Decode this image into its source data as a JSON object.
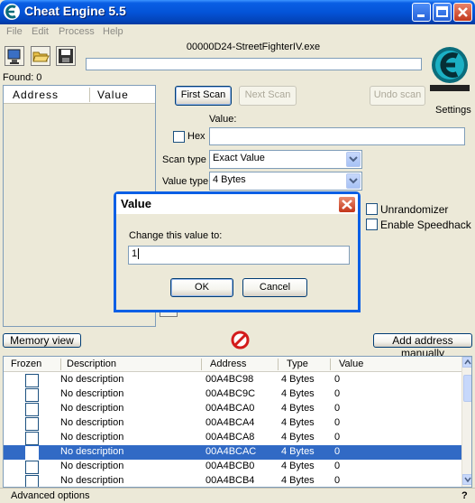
{
  "window": {
    "title": "Cheat Engine 5.5"
  },
  "menu": [
    "File",
    "Edit",
    "Process",
    "Help"
  ],
  "process": {
    "name": "00000D24-StreetFighterIV.exe",
    "found_label": "Found: 0"
  },
  "results": {
    "columns": [
      "Address",
      "Value"
    ]
  },
  "scan": {
    "first_scan": "First Scan",
    "next_scan": "Next Scan",
    "undo_scan": "Undo scan",
    "value_label": "Value:",
    "hex_label": "Hex",
    "scan_type_label": "Scan type",
    "scan_type_value": "Exact Value",
    "value_type_label": "Value type",
    "value_type_value": "4 Bytes",
    "unrandomizer": "Unrandomizer",
    "speedhack": "Enable Speedhack",
    "settings": "Settings"
  },
  "actions": {
    "memory_view": "Memory view",
    "add_address": "Add address manually"
  },
  "address_list": {
    "columns": [
      "Frozen",
      "Description",
      "Address",
      "Type",
      "Value"
    ],
    "rows": [
      {
        "description": "No description",
        "address": "00A4BC98",
        "type": "4 Bytes",
        "value": "0"
      },
      {
        "description": "No description",
        "address": "00A4BC9C",
        "type": "4 Bytes",
        "value": "0"
      },
      {
        "description": "No description",
        "address": "00A4BCA0",
        "type": "4 Bytes",
        "value": "0"
      },
      {
        "description": "No description",
        "address": "00A4BCA4",
        "type": "4 Bytes",
        "value": "0"
      },
      {
        "description": "No description",
        "address": "00A4BCA8",
        "type": "4 Bytes",
        "value": "0"
      },
      {
        "description": "No description",
        "address": "00A4BCAC",
        "type": "4 Bytes",
        "value": "0"
      },
      {
        "description": "No description",
        "address": "00A4BCB0",
        "type": "4 Bytes",
        "value": "0"
      },
      {
        "description": "No description",
        "address": "00A4BCB4",
        "type": "4 Bytes",
        "value": "0"
      }
    ]
  },
  "status": {
    "advanced": "Advanced options",
    "help": "?"
  },
  "dialog": {
    "title": "Value",
    "prompt": "Change this value to:",
    "input_value": "1",
    "ok": "OK",
    "cancel": "Cancel"
  }
}
